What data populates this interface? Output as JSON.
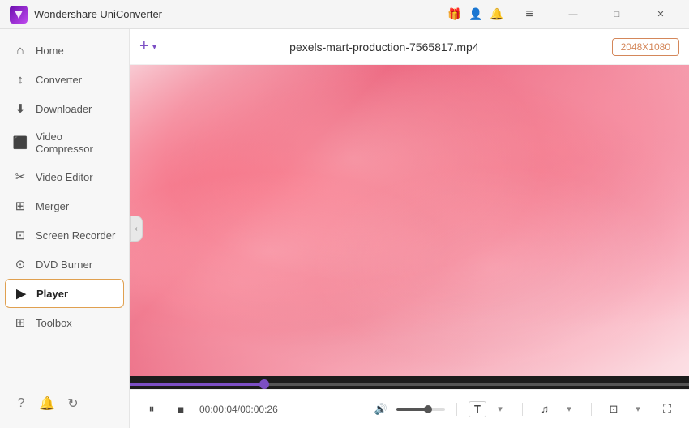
{
  "titlebar": {
    "title": "Wondershare UniConverter",
    "logo_color": "#7b3fc4"
  },
  "sidebar": {
    "items": [
      {
        "id": "home",
        "label": "Home",
        "icon": "⌂",
        "active": false
      },
      {
        "id": "converter",
        "label": "Converter",
        "icon": "↕",
        "active": false
      },
      {
        "id": "downloader",
        "label": "Downloader",
        "icon": "⬇",
        "active": false
      },
      {
        "id": "video-compressor",
        "label": "Video Compressor",
        "icon": "⬛",
        "active": false
      },
      {
        "id": "video-editor",
        "label": "Video Editor",
        "icon": "✂",
        "active": false
      },
      {
        "id": "merger",
        "label": "Merger",
        "icon": "⊞",
        "active": false
      },
      {
        "id": "screen-recorder",
        "label": "Screen Recorder",
        "icon": "⊡",
        "active": false
      },
      {
        "id": "dvd-burner",
        "label": "DVD Burner",
        "icon": "⊙",
        "active": false
      },
      {
        "id": "player",
        "label": "Player",
        "icon": "▶",
        "active": true
      },
      {
        "id": "toolbox",
        "label": "Toolbox",
        "icon": "⊞",
        "active": false
      }
    ],
    "bottom_icons": [
      "?",
      "🔔",
      "↻"
    ]
  },
  "player": {
    "filename": "pexels-mart-production-7565817.mp4",
    "resolution": "2048X1080",
    "timecode_current": "00:04",
    "timecode_total": "00:26",
    "progress_percent": 24,
    "volume_percent": 65
  },
  "icons": {
    "add": "+",
    "play": "▶",
    "pause": "⏸",
    "stop": "■",
    "volume": "🔊",
    "subtitle": "T",
    "audio": "♫",
    "screenshot": "⊡",
    "fullscreen": "⛶",
    "chevron_down": "▾",
    "chevron_left": "‹",
    "minimize": "—",
    "maximize": "□",
    "close": "✕",
    "gift": "🎁",
    "user": "👤",
    "bell": "🔔",
    "menu": "≡"
  }
}
